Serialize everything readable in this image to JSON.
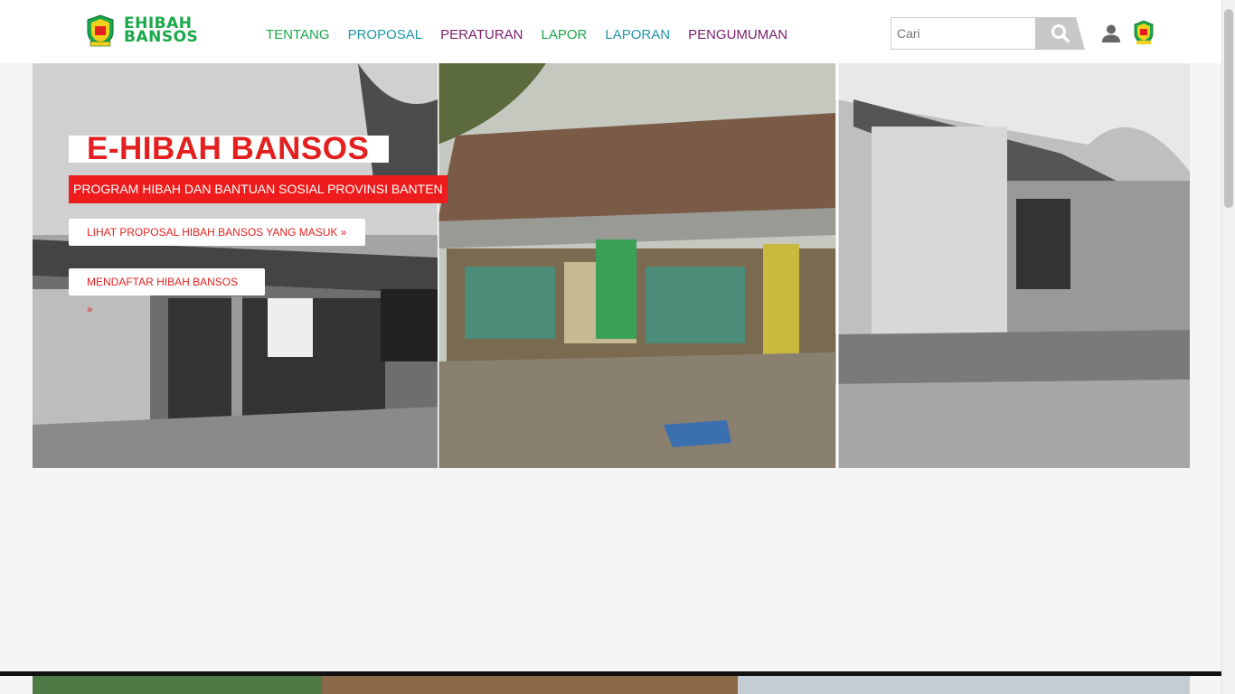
{
  "brand": {
    "line1": "EHIBAH",
    "line2": "BANSOS"
  },
  "nav": [
    {
      "label": "TENTANG",
      "color": "#1aa84a"
    },
    {
      "label": "PROPOSAL",
      "color": "#2196a8"
    },
    {
      "label": "PERATURAN",
      "color": "#7b1f6e"
    },
    {
      "label": "LAPOR",
      "color": "#1aa84a"
    },
    {
      "label": "LAPORAN",
      "color": "#2196a8"
    },
    {
      "label": "PENGUMUMAN",
      "color": "#7b1f6e"
    }
  ],
  "search": {
    "placeholder": "Cari"
  },
  "hero": {
    "title": "E-HIBAH BANSOS",
    "subtitle": "PROGRAM HIBAH DAN BANTUAN SOSIAL PROVINSI BANTEN",
    "btn_proposals": "LIHAT PROPOSAL HIBAH BANSOS YANG MASUK »",
    "btn_register": "MENDAFTAR HIBAH BANSOS »"
  },
  "colors": {
    "brand_green": "#1aa84a",
    "accent_red": "#e41f1f",
    "teal": "#2196a8",
    "purple": "#7b1f6e"
  },
  "icons": {
    "search": "search-icon",
    "user": "user-icon",
    "emblem": "province-emblem-icon"
  }
}
